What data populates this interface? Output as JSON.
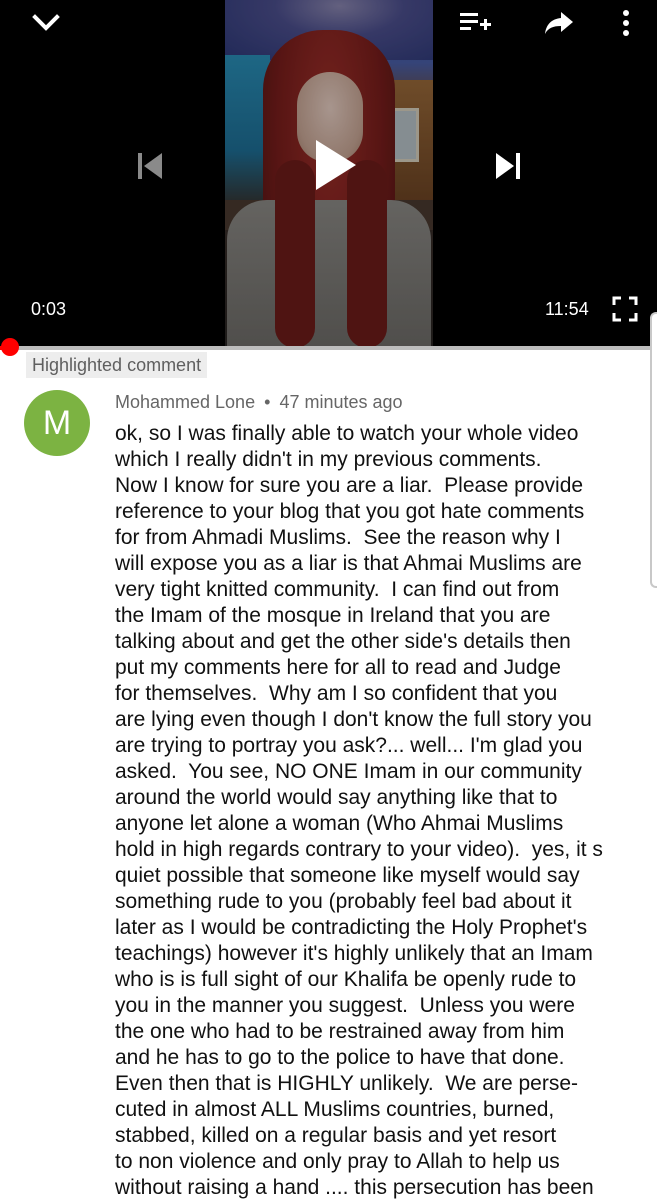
{
  "player": {
    "time_current": "0:03",
    "time_total": "11:54",
    "progress_fraction": 0.004,
    "icons": {
      "minimize": "chevron-down-icon",
      "add_to_queue": "add-to-queue-icon",
      "share": "share-icon",
      "more": "more-vertical-icon",
      "previous": "skip-previous-icon",
      "play": "play-icon",
      "next": "skip-next-icon",
      "fullscreen": "fullscreen-icon"
    },
    "colors": {
      "progress": "#ff0000",
      "track": "#bdbdbd",
      "background": "#000000"
    }
  },
  "comment": {
    "badge": "Highlighted comment",
    "avatar_letter": "M",
    "avatar_color": "#7cb342",
    "author": "Mohammed Lone",
    "separator": "•",
    "time_ago": "47 minutes ago",
    "lines": [
      "ok, so I was finally able to watch your whole video",
      "which I really didn't in my previous comments.",
      "Now I know for sure you are a liar.  Please provide",
      "reference to your blog that you got hate comments",
      "for from Ahmadi Muslims.  See the reason why I",
      "will expose you as a liar is that Ahmai Muslims are",
      "very tight knitted community.  I can find out from",
      "the Imam of the mosque in Ireland that you are",
      "talking about and get the other side's details then",
      "put my comments here for all to read and Judge",
      "for themselves.  Why am I so confident that you",
      "are lying even though I don't know the full story you",
      "are trying to portray you ask?... well... I'm glad you",
      "asked.  You see, NO ONE Imam in our community",
      "around the world would say anything like that to",
      "anyone let alone a woman (Who Ahmai Muslims",
      "hold in high regards contrary to your video).  yes, it s",
      "quiet possible that someone like myself would say",
      "something rude to you (probably feel bad about it",
      "later as I would be contradicting the Holy Prophet's",
      "teachings) however it's highly unlikely that an Imam",
      "who is is full sight of our Khalifa be openly rude to",
      "you in the manner you suggest.  Unless you were",
      "the one who had to be restrained away from him",
      "and he has to go to the police to have that done.",
      "Even then that is HIGHLY unlikely.  We are perse-",
      "cuted in almost ALL Muslims countries, burned,",
      "stabbed, killed on a regular basis and yet resort",
      "to non violence and only pray to Allah to help us",
      "without raising a hand .... this persecution has been"
    ]
  }
}
